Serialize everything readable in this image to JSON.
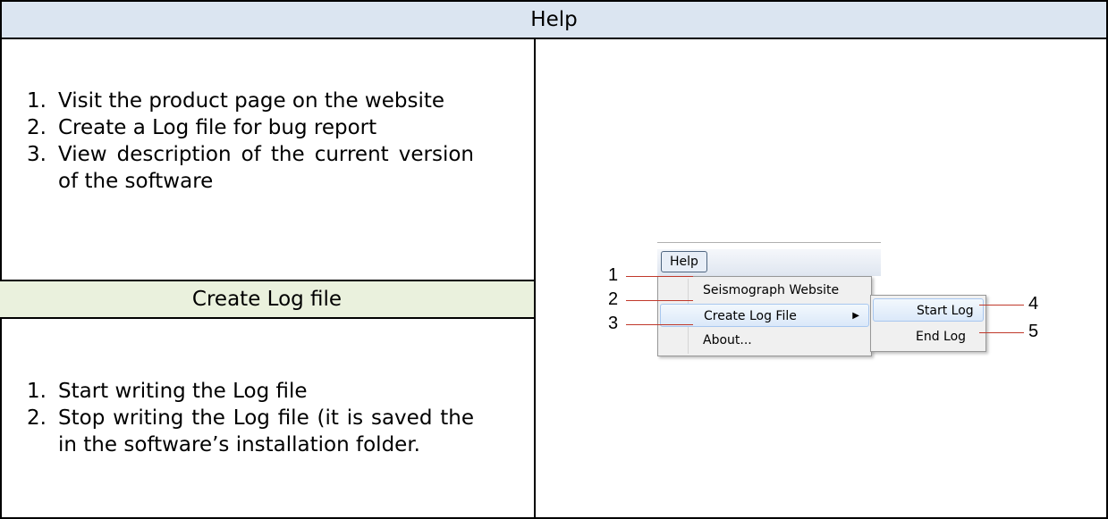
{
  "header": {
    "title": "Help"
  },
  "help_list": [
    {
      "num": "1.",
      "text": "Visit the product page on the website"
    },
    {
      "num": "2.",
      "text": "Create a Log file for bug report"
    },
    {
      "num": "3.",
      "text": "View description of the current version of the software"
    }
  ],
  "log_section": {
    "title": "Create Log file"
  },
  "log_list": [
    {
      "num": "1.",
      "text": "Start writing the Log file"
    },
    {
      "num": "2.",
      "text": "Stop writing the Log file (it is saved the in the software’s installation folder."
    }
  ],
  "menu": {
    "help_label": "Help",
    "items": [
      "Seismograph Website",
      "Create Log File",
      "About..."
    ],
    "submenu_items": [
      "Start Log",
      "End Log"
    ],
    "submenu_arrow": "▶"
  },
  "callouts": [
    "1",
    "2",
    "3",
    "4",
    "5"
  ],
  "colors": {
    "header_bg": "#dbe5f1",
    "subheader_bg": "#eaf1dd",
    "callout_line": "#c0392b"
  }
}
